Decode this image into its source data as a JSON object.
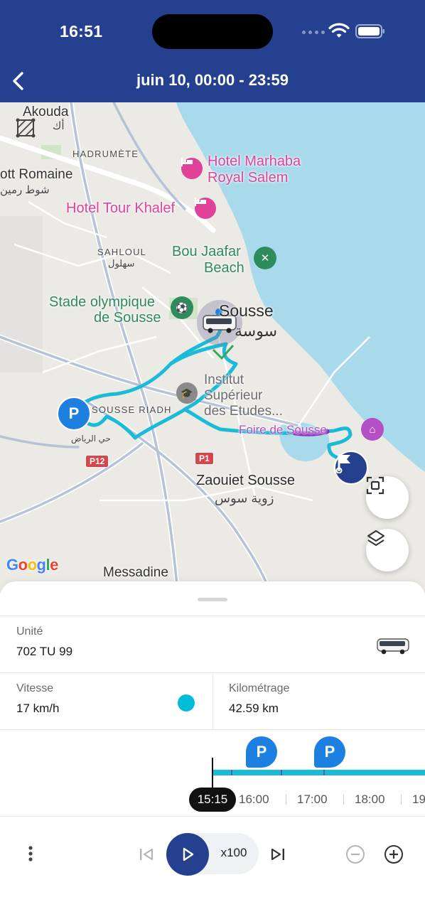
{
  "status_bar": {
    "time": "16:51"
  },
  "header": {
    "title": "juin 10, 00:00 - 23:59"
  },
  "map": {
    "labels": {
      "akouda": "Akouda",
      "akouda_ar": "أك",
      "hadrumete": "HADRUMÈTE",
      "ott_romaine": "ott Romaine",
      "ott_romaine_ar": "شوط رمين",
      "hotel_marhaba": "Hotel Marhaba",
      "hotel_marhaba_2": "Royal Salem",
      "hotel_tour_khalef": "Hotel Tour Khalef",
      "sahloul": "SAHLOUL",
      "sahloul_ar": "سهلول",
      "bou_jaafar": "Bou Jaafar",
      "bou_jaafar_2": "Beach",
      "stade": "Stade olympique",
      "stade_2": "de Sousse",
      "sousse": "Sousse",
      "sousse_ar": "سوسة",
      "institut_1": "Institut",
      "institut_2": "Supérieur",
      "institut_3": "des Etudes...",
      "sousse_riadh": "SOUSSE RIADH",
      "riadh_ar": "حي الرياض",
      "foire": "Foire de Sousse",
      "zaouiet": "Zaouiet Sousse",
      "zaouiet_ar": "زوية سوس",
      "messadine": "Messadine",
      "p1": "P1",
      "p12": "P12",
      "google": "Google",
      "parking_pin": "P"
    },
    "track_color": "#1bbbd8",
    "track_highlight_color": "#8a2bb8"
  },
  "unit": {
    "label": "Unité",
    "value": "702 TU 99"
  },
  "speed": {
    "label": "Vitesse",
    "value": "17 km/h",
    "indicator_color": "#00bcd9"
  },
  "mileage": {
    "label": "Kilométrage",
    "value": "42.59 km"
  },
  "timeline": {
    "current_time": "15:15",
    "ticks": [
      "16:00",
      "17:00",
      "18:00",
      "19"
    ],
    "parking_marker": "P"
  },
  "playback": {
    "speed": "x100"
  },
  "colors": {
    "brand": "#24408e",
    "accent": "#1d7fe0"
  }
}
